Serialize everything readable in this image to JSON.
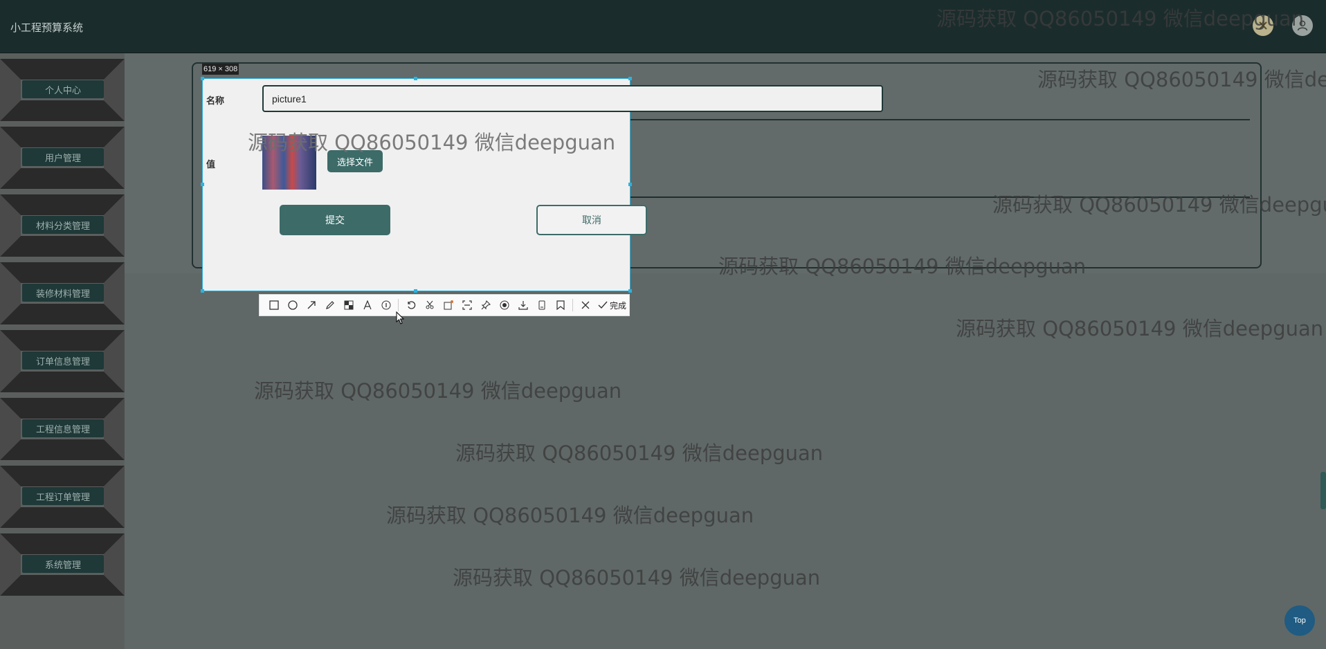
{
  "app": {
    "title": "小工程预算系统"
  },
  "header": {
    "close_icon": "close-x-icon",
    "user_icon": "user-icon"
  },
  "sidebar": {
    "items": [
      {
        "label": "个人中心"
      },
      {
        "label": "用户管理"
      },
      {
        "label": "材料分类管理"
      },
      {
        "label": "装修材料管理"
      },
      {
        "label": "订单信息管理"
      },
      {
        "label": "工程信息管理"
      },
      {
        "label": "工程订单管理"
      },
      {
        "label": "系统管理"
      }
    ]
  },
  "dialog": {
    "size_label": "619 × 308",
    "name_label": "名称",
    "name_value": "picture1",
    "value_label": "值",
    "file_button": "选择文件",
    "submit_button": "提交",
    "cancel_button": "取消"
  },
  "screenshot_toolbar": {
    "tools": [
      "rectangle-icon",
      "ellipse-icon",
      "arrow-icon",
      "pencil-icon",
      "mosaic-icon",
      "text-icon",
      "number-icon",
      "undo-icon",
      "crop-icon",
      "ocr-icon",
      "scan-icon",
      "pin-icon",
      "record-icon",
      "download-icon",
      "save-icon",
      "bookmark-icon",
      "cancel-icon"
    ],
    "done_label": "完成"
  },
  "watermark": {
    "text": "源码获取 QQ86050149 微信deepguan"
  },
  "back_to_top": {
    "label": "Top"
  },
  "colors": {
    "accent": "#3c6b68",
    "header_bg": "#1b2c2c",
    "selection": "#2bb3e0"
  }
}
